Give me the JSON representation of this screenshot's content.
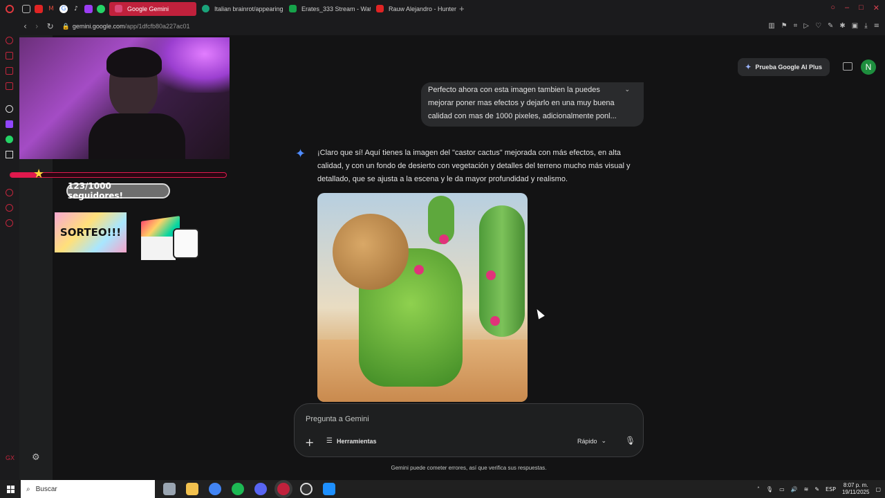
{
  "browser": {
    "tabs": [
      {
        "title": "Google Gemini",
        "active": true,
        "color": "#c0213c"
      },
      {
        "title": "Italian brainrot/appearing",
        "active": false,
        "color": "#1aa37a"
      },
      {
        "title": "Erates_333 Stream - Wat",
        "active": false,
        "color": "#16a34a"
      },
      {
        "title": "Rauw Alejandro - Hunter",
        "active": false,
        "color": "#e02424"
      }
    ],
    "new_tab": "+",
    "url_host": "gemini.google.com",
    "url_path": "/app/1dfcfb80a227ac01"
  },
  "header": {
    "plus_label": "Prueba Google AI Plus",
    "avatar_letter": "N",
    "avatar_color": "#1e8e3e"
  },
  "overlay": {
    "followers": "123/1000 seguidores!",
    "followers_progress": 0.123,
    "sorteo": "SORTEO!!!"
  },
  "chat": {
    "user_message": "Perfecto ahora con esta imagen tambien la puedes mejorar poner mas efectos y dejarlo en una muy buena calidad con mas de 1000 pixeles, adicionalmente ponl...",
    "reply": "¡Claro que sí! Aquí tienes la imagen del \"castor cactus\" mejorada con más efectos, en alta calidad, y con un fondo de desierto con vegetación y detalles del terreno mucho más visual y detallado, que se ajusta a la escena y le da mayor profundidad y realismo."
  },
  "input": {
    "placeholder": "Pregunta a Gemini",
    "tools_label": "Herramientas",
    "mode_label": "Rápido",
    "disclaimer": "Gemini puede cometer errores, así que verifica sus respuestas."
  },
  "taskbar": {
    "search_label": "Buscar",
    "language": "ESP",
    "time": "8:07 p. m.",
    "date": "19/11/2025"
  },
  "icons": {
    "gemini_spark": "✦",
    "plus": "+",
    "mic": "🎙",
    "chevron": "⌄"
  }
}
